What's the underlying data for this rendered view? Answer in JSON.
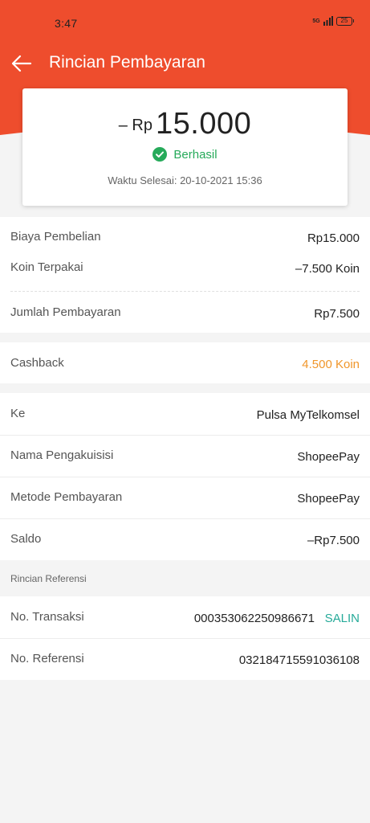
{
  "status_bar": {
    "time": "3:47",
    "network": "5G",
    "battery": "25"
  },
  "nav": {
    "title": "Rincian Pembayaran",
    "back_icon": "arrow-left-icon"
  },
  "summary": {
    "prefix": "– Rp",
    "amount": "15.000",
    "status": "Berhasil",
    "completed_time": "Waktu Selesai: 20-10-2021 15:36"
  },
  "payment": {
    "rows": [
      {
        "label": "Biaya Pembelian",
        "value": "Rp15.000"
      },
      {
        "label": "Koin Terpakai",
        "value": "–7.500 Koin"
      }
    ],
    "total_label": "Jumlah Pembayaran",
    "total_value": "Rp7.500"
  },
  "cashback": {
    "label": "Cashback",
    "value": "4.500 Koin"
  },
  "details": [
    {
      "label": "Ke",
      "value": "Pulsa MyTelkomsel"
    },
    {
      "label": "Nama Pengakuisisi",
      "value": "ShopeePay"
    },
    {
      "label": "Metode Pembayaran",
      "value": "ShopeePay"
    },
    {
      "label": "Saldo",
      "value": "–Rp7.500"
    }
  ],
  "reference": {
    "header": "Rincian Referensi",
    "transaction_label": "No. Transaksi",
    "transaction_value": "000353062250986671",
    "copy_label": "SALIN",
    "reference_label": "No. Referensi",
    "reference_value": "032184715591036108"
  },
  "colors": {
    "brand": "#ee4d2d",
    "success": "#26aa5a",
    "cashback": "#f0962a",
    "copy": "#26aa99",
    "background": "#f4f4f4"
  }
}
